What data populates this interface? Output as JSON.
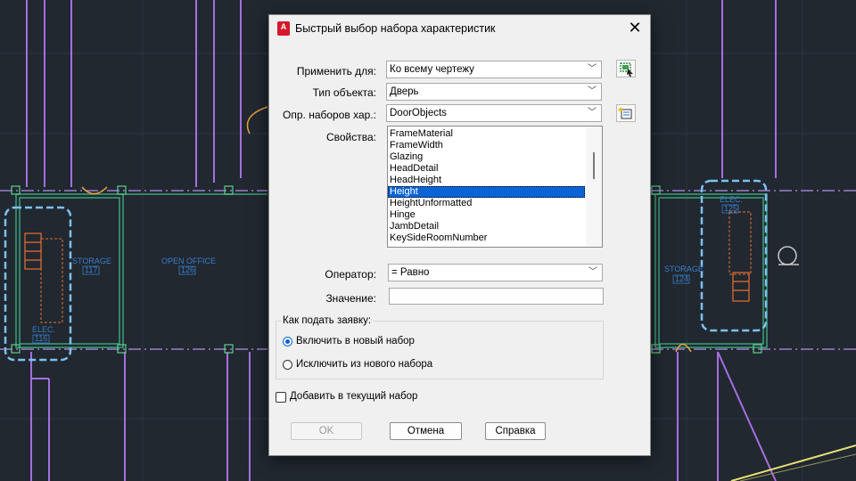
{
  "background": {
    "rooms": [
      {
        "name": "STORAGE",
        "number": "117"
      },
      {
        "name": "OPEN OFFICE",
        "number": "126"
      },
      {
        "name": "ELEC.",
        "number": "116"
      },
      {
        "name": "STORAGE",
        "number": "124"
      },
      {
        "name": "ELEC.",
        "number": "125"
      }
    ]
  },
  "dialog": {
    "title": "Быстрый выбор набора характеристик",
    "app_icon_letter": "A",
    "apply_to_label": "Применить для:",
    "apply_to_value": "Ко всему чертежу",
    "object_type_label": "Тип объекта:",
    "object_type_value": "Дверь",
    "property_set_label": "Опр. наборов хар.:",
    "property_set_value": "DoorObjects",
    "properties_label": "Свойства:",
    "properties": [
      {
        "label": "FrameMaterial",
        "selected": false
      },
      {
        "label": "FrameWidth",
        "selected": false
      },
      {
        "label": "Glazing",
        "selected": false
      },
      {
        "label": "HeadDetail",
        "selected": false
      },
      {
        "label": "HeadHeight",
        "selected": false
      },
      {
        "label": "Height",
        "selected": true
      },
      {
        "label": "HeightUnformatted",
        "selected": false
      },
      {
        "label": "Hinge",
        "selected": false
      },
      {
        "label": "JambDetail",
        "selected": false
      },
      {
        "label": "KeySideRoomNumber",
        "selected": false
      }
    ],
    "operator_label": "Оператор:",
    "operator_value": "= Равно",
    "value_label": "Значение:",
    "value_text": "",
    "apply_group_title": "Как подать заявку:",
    "include_label": "Включить в новый набор",
    "exclude_label": "Исключить из нового набора",
    "selected_mode": "include",
    "append_label": "Добавить в текущий набор",
    "append_checked": false,
    "ok_label": "OK",
    "cancel_label": "Отмена",
    "help_label": "Справка"
  }
}
